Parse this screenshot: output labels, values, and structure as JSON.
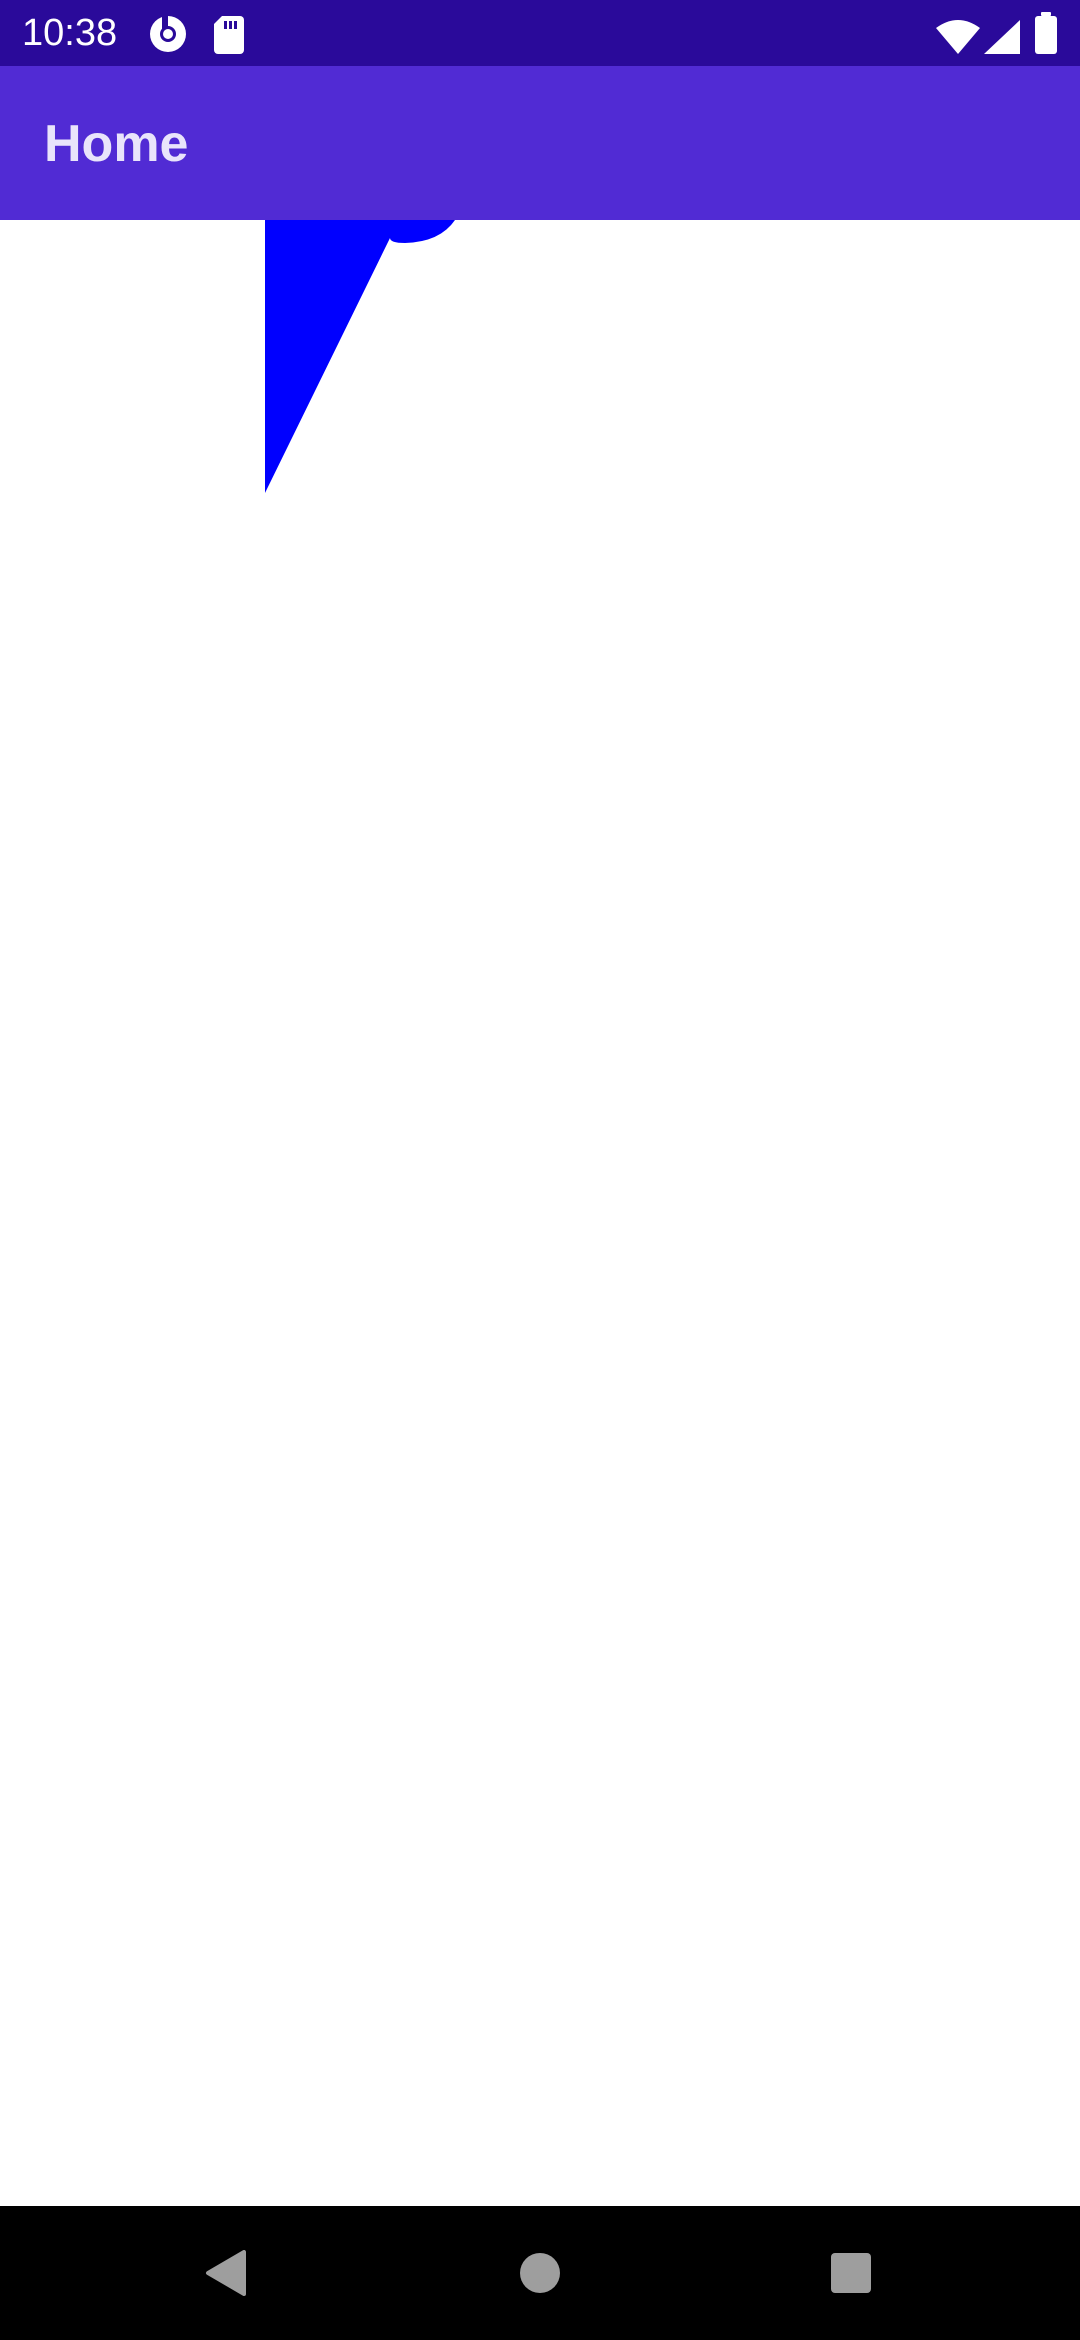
{
  "status_bar": {
    "time": "10:38",
    "left_icons": [
      "data-saver-icon",
      "sd-card-icon"
    ],
    "right_icons": [
      "wifi-icon",
      "cellular-signal-icon",
      "battery-icon"
    ],
    "background": "#2a0a9a"
  },
  "app_bar": {
    "title": "Home",
    "background": "#512bd4"
  },
  "content": {
    "shape_color": "#0000ff",
    "shape_description_icon": "blue-triangle-shape"
  },
  "nav_bar": {
    "buttons": [
      "back-icon",
      "home-icon",
      "recents-icon"
    ],
    "icon_color": "#9e9e9e"
  }
}
